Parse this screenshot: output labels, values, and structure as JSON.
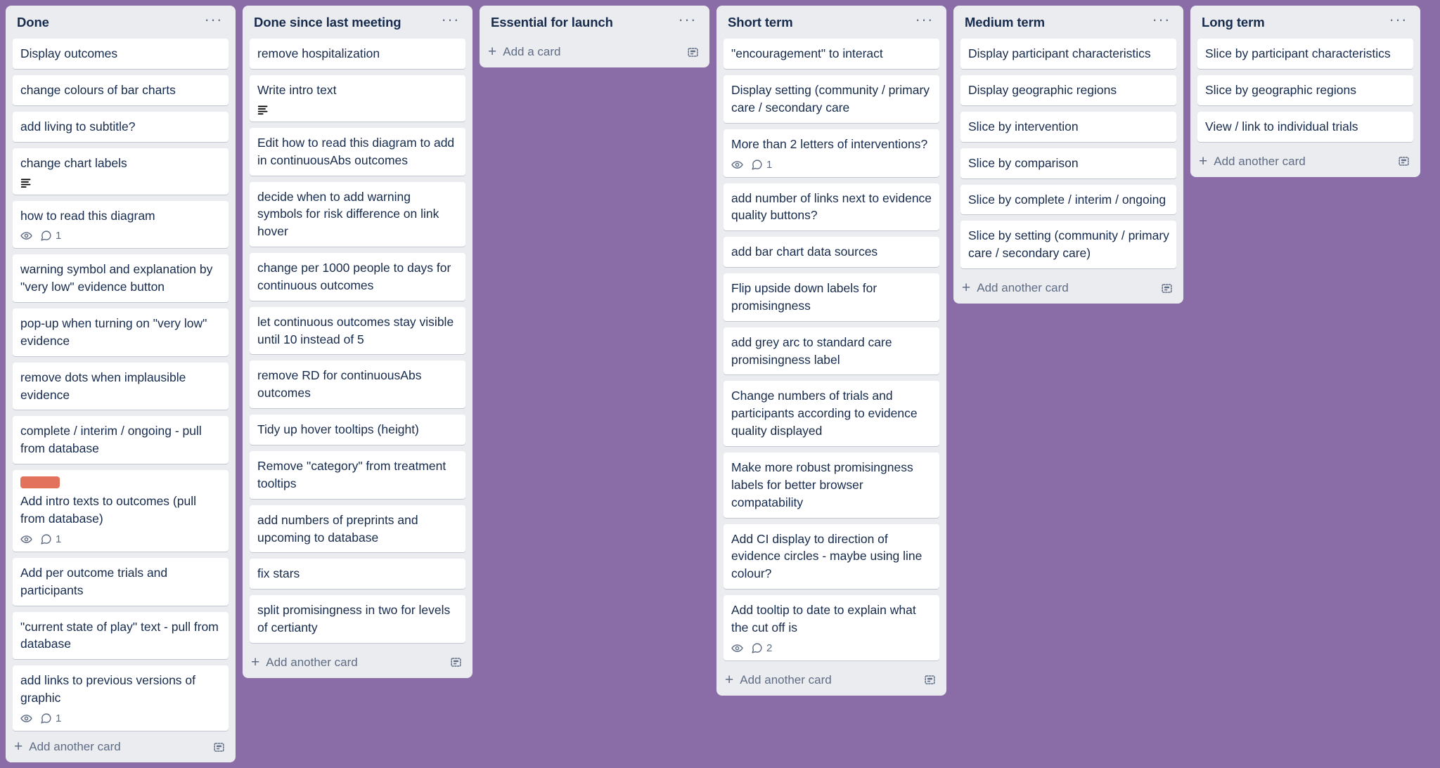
{
  "board": {
    "background_color": "#8a6ca6",
    "list_background": "#ebecf0",
    "card_background": "#ffffff",
    "text_color": "#172b4d",
    "muted_text_color": "#5e6c84"
  },
  "icons": {
    "list_menu": "···",
    "plus": "+",
    "eye": "eye-icon",
    "comment": "comment-icon",
    "description": "description-icon",
    "template": "card-template-icon"
  },
  "lists": [
    {
      "title": "Done",
      "footer_label": "Add another card",
      "has_template_button": true,
      "scrollable": true,
      "cards": [
        {
          "title": "Display outcomes"
        },
        {
          "title": "change colours of bar charts"
        },
        {
          "title": "add living to subtitle?"
        },
        {
          "title": "change chart labels",
          "description": true
        },
        {
          "title": "how to read this diagram",
          "watching": true,
          "comments": "1"
        },
        {
          "title": "warning symbol and explanation by \"very low\" evidence button"
        },
        {
          "title": "pop-up when turning on \"very low\" evidence"
        },
        {
          "title": "remove dots when implausible evidence"
        },
        {
          "title": "complete / interim / ongoing - pull from database"
        },
        {
          "title": "Add intro texts to outcomes (pull from database)",
          "label_color": "#e2725b",
          "watching": true,
          "comments": "1"
        },
        {
          "title": "Add per outcome trials and participants"
        },
        {
          "title": "\"current state of play\" text - pull from database"
        },
        {
          "title": "add links to previous versions of graphic",
          "watching": true,
          "comments": "1"
        }
      ]
    },
    {
      "title": "Done since last meeting",
      "footer_label": "Add another card",
      "has_template_button": true,
      "scrollable": true,
      "cards": [
        {
          "title": "remove hospitalization"
        },
        {
          "title": "Write intro text",
          "description": true
        },
        {
          "title": "Edit how to read this diagram to add in continuousAbs outcomes"
        },
        {
          "title": "decide when to add warning symbols for risk difference on link hover"
        },
        {
          "title": "change per 1000 people to days for continuous outcomes"
        },
        {
          "title": "let continuous outcomes stay visible until 10 instead of 5"
        },
        {
          "title": "remove RD for continuousAbs outcomes"
        },
        {
          "title": "Tidy up hover tooltips (height)"
        },
        {
          "title": "Remove \"category\" from treatment tooltips"
        },
        {
          "title": "add numbers of preprints and upcoming to database"
        },
        {
          "title": "fix stars"
        },
        {
          "title": "split promisingness in two for levels of certianty"
        }
      ]
    },
    {
      "title": "Essential for launch",
      "footer_label": "Add a card",
      "has_template_button": true,
      "scrollable": false,
      "cards": []
    },
    {
      "title": "Short term",
      "footer_label": "Add another card",
      "has_template_button": true,
      "scrollable": false,
      "cards": [
        {
          "title": "\"encouragement\" to interact"
        },
        {
          "title": "Display setting (community / primary care / secondary care"
        },
        {
          "title": "More than 2 letters of interventions?",
          "watching": true,
          "comments": "1"
        },
        {
          "title": "add number of links next to evidence quality buttons?"
        },
        {
          "title": "add bar chart data sources"
        },
        {
          "title": "Flip upside down labels for promisingness"
        },
        {
          "title": "add grey arc to standard care promisingness label"
        },
        {
          "title": "Change numbers of trials and participants according to evidence quality displayed"
        },
        {
          "title": "Make more robust promisingness labels for better browser compatability"
        },
        {
          "title": "Add CI display to direction of evidence circles - maybe using line colour?"
        },
        {
          "title": "Add tooltip to date to explain what the cut off is",
          "watching": true,
          "comments": "2"
        }
      ]
    },
    {
      "title": "Medium term",
      "footer_label": "Add another card",
      "has_template_button": true,
      "scrollable": false,
      "cards": [
        {
          "title": "Display participant characteristics"
        },
        {
          "title": "Display geographic regions"
        },
        {
          "title": "Slice by intervention"
        },
        {
          "title": "Slice by comparison"
        },
        {
          "title": "Slice by complete / interim / ongoing"
        },
        {
          "title": "Slice by setting (community / primary care / secondary care)"
        }
      ]
    },
    {
      "title": "Long term",
      "footer_label": "Add another card",
      "has_template_button": true,
      "scrollable": false,
      "cards": [
        {
          "title": "Slice by participant characteristics"
        },
        {
          "title": "Slice by geographic regions"
        },
        {
          "title": "View / link to individual trials"
        }
      ]
    }
  ]
}
